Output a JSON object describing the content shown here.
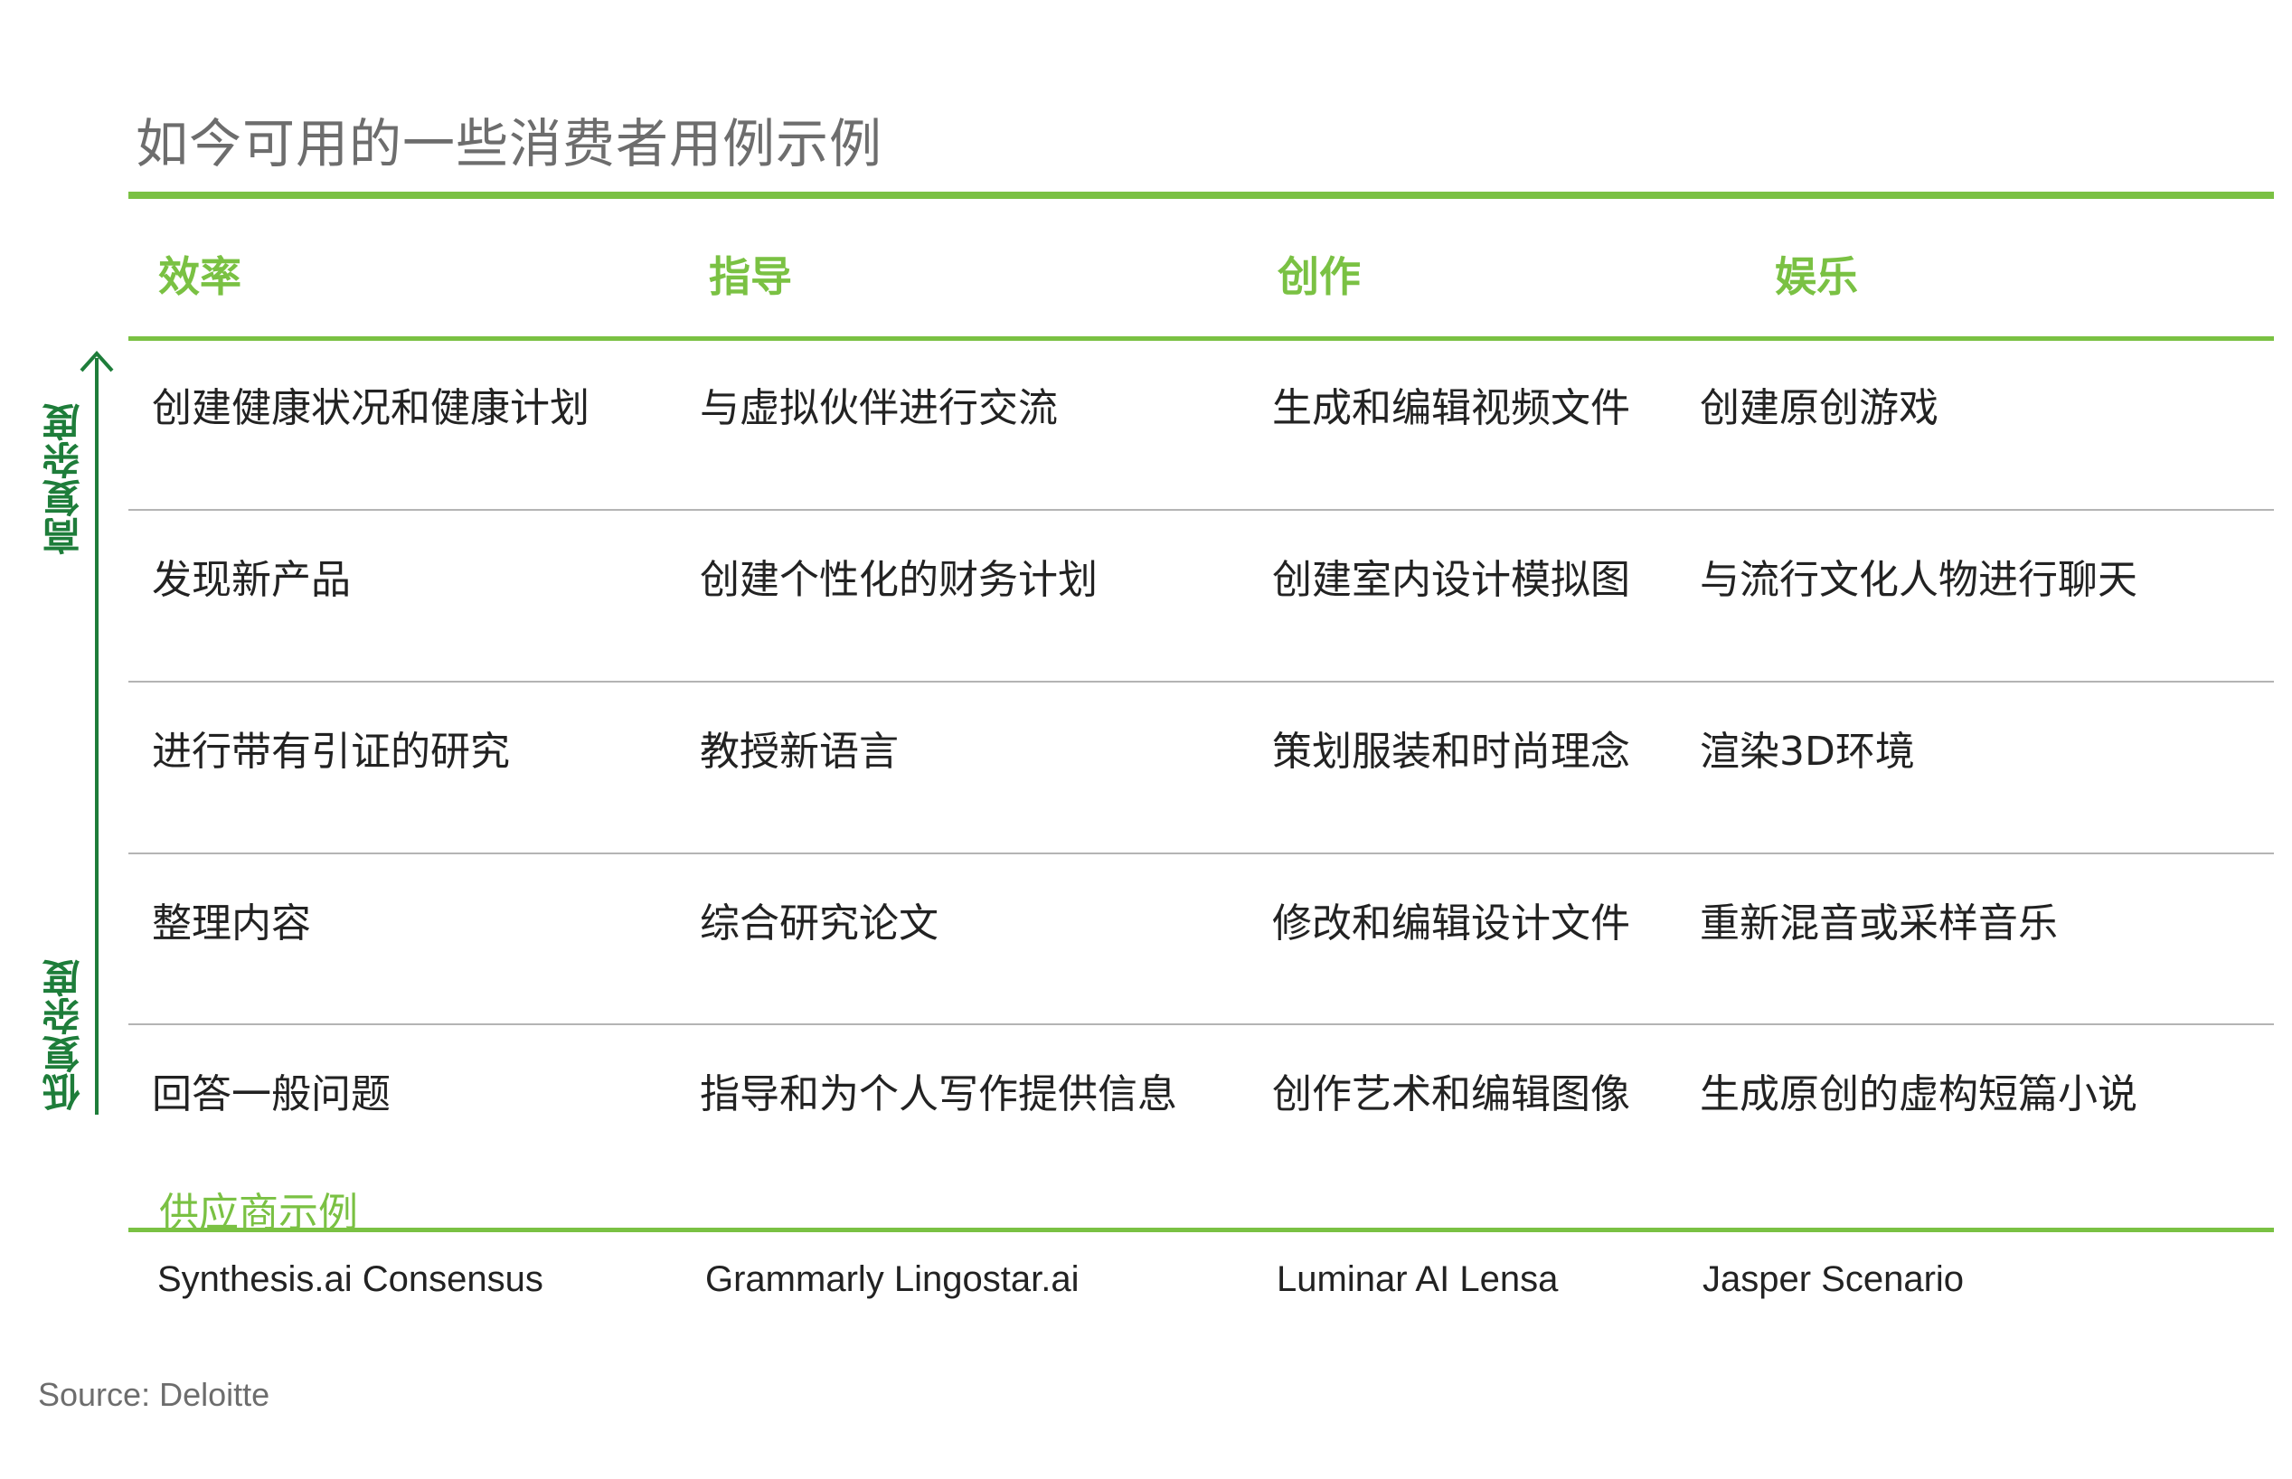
{
  "title": "如今可用的一些消费者用例示例",
  "columns": [
    "效率",
    "指导",
    "创作",
    "娱乐"
  ],
  "axis": {
    "high_label": "高复杂度",
    "low_label": "低复杂度",
    "color": "#1e7d3a"
  },
  "rows": [
    [
      "创建健康状况和健康计划",
      "与虚拟伙伴进行交流",
      "生成和编辑视频文件",
      "创建原创游戏"
    ],
    [
      "发现新产品",
      "创建个性化的财务计划",
      "创建室内设计模拟图",
      "与流行文化人物进行聊天"
    ],
    [
      "进行带有引证的研究",
      "教授新语言",
      "策划服装和时尚理念",
      "渲染3D环境"
    ],
    [
      "整理内容",
      "综合研究论文",
      "修改和编辑设计文件",
      "重新混音或采样音乐"
    ],
    [
      "回答一般问题",
      "指导和为个人写作提供信息",
      "创作艺术和编辑图像",
      "生成原创的虚构短篇小说"
    ]
  ],
  "vendor_label": "供应商示例",
  "vendors": [
    "Synthesis.ai  Consensus",
    "Grammarly  Lingostar.ai",
    "Luminar AI  Lensa",
    "Jasper  Scenario"
  ],
  "source": "Source: Deloitte",
  "colors": {
    "accent_green": "#7ac143",
    "axis_green": "#1e7d3a",
    "title_gray": "#6d6d6d",
    "rule_gray": "#b4b4b4"
  }
}
